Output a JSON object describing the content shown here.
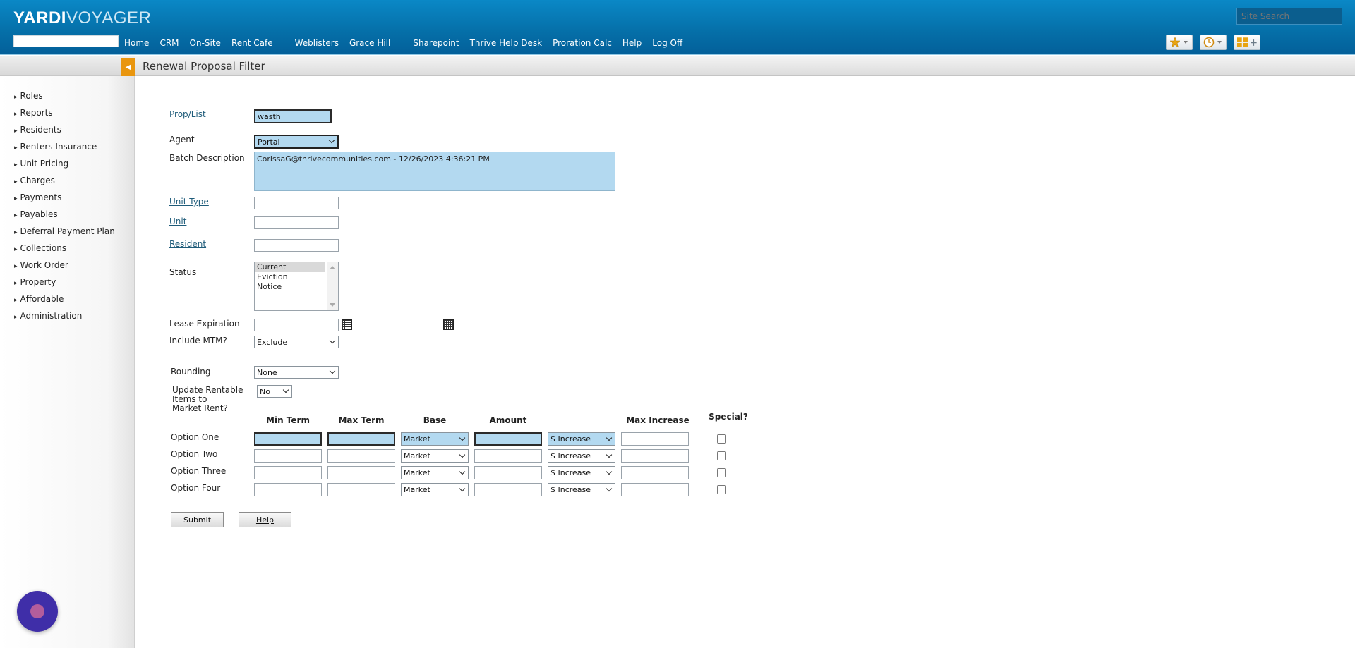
{
  "header": {
    "logo_part1": "YARDI",
    "logo_part2": "VOYAGER",
    "site_search_placeholder": "Site Search",
    "nav": [
      "Home",
      "CRM",
      "On-Site",
      "Rent Cafe",
      "Weblisters",
      "Grace Hill",
      "Sharepoint",
      "Thrive Help Desk",
      "Proration Calc",
      "Help",
      "Log Off"
    ]
  },
  "sidebar": {
    "items": [
      "Roles",
      "Reports",
      "Residents",
      "Renters Insurance",
      "Unit Pricing",
      "Charges",
      "Payments",
      "Payables",
      "Deferral Payment Plan",
      "Collections",
      "Work Order",
      "Property",
      "Affordable",
      "Administration"
    ]
  },
  "page": {
    "title": "Renewal Proposal Filter"
  },
  "form": {
    "prop_list_label": "Prop/List",
    "prop_list_value": "wasth",
    "agent_label": "Agent",
    "agent_value": "Portal",
    "batch_label": "Batch Description",
    "batch_value": "CorissaG@thrivecommunities.com - 12/26/2023 4:36:21 PM",
    "unit_type_label": "Unit Type",
    "unit_label": "Unit",
    "resident_label": "Resident",
    "status_label": "Status",
    "status_options": [
      "Current",
      "Eviction",
      "Notice"
    ],
    "lease_exp_label": "Lease Expiration",
    "include_mtm_label": "Include MTM?",
    "include_mtm_value": "Exclude",
    "rounding_label": "Rounding",
    "rounding_value": "None",
    "update_rentable_label_1": "Update Rentable",
    "update_rentable_label_2": "Items to",
    "update_rentable_label_3": "Market Rent?",
    "update_rentable_value": "No",
    "columns": {
      "min_term": "Min Term",
      "max_term": "Max Term",
      "base": "Base",
      "amount": "Amount",
      "max_increase": "Max Increase",
      "special": "Special?"
    },
    "options": [
      {
        "label": "Option One",
        "base": "Market",
        "type": "$ Increase"
      },
      {
        "label": "Option Two",
        "base": "Market",
        "type": "$ Increase"
      },
      {
        "label": "Option Three",
        "base": "Market",
        "type": "$ Increase"
      },
      {
        "label": "Option Four",
        "base": "Market",
        "type": "$ Increase"
      }
    ],
    "submit_label": "Submit",
    "help_label": "Help"
  },
  "colors": {
    "header_blue": "#056fa8",
    "highlight_blue": "#b3d9f0",
    "collapse_orange": "#e9960f"
  },
  "icons": {
    "favorites": "star-icon",
    "history": "clock-icon",
    "dashboard": "grid-icon",
    "calendar": "calendar-icon",
    "chat": "chat-bubble-icon"
  }
}
